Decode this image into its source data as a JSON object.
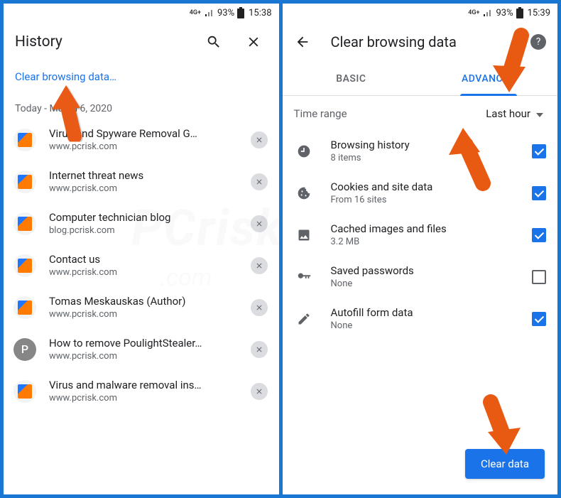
{
  "left": {
    "status": {
      "network": "4G+",
      "battery_pct": "93%",
      "time": "15:38"
    },
    "header": {
      "title": "History"
    },
    "clear_link": "Clear browsing data…",
    "date_header": "Today - March 6, 2020",
    "items": [
      {
        "title": "Virus and Spyware Removal G…",
        "url": "www.pcrisk.com",
        "icon": "pcrisk"
      },
      {
        "title": "Internet threat news",
        "url": "www.pcrisk.com",
        "icon": "pcrisk"
      },
      {
        "title": "Computer technician blog",
        "url": "blog.pcrisk.com",
        "icon": "pcrisk"
      },
      {
        "title": "Contact us",
        "url": "www.pcrisk.com",
        "icon": "pcrisk"
      },
      {
        "title": "Tomas Meskauskas (Author)",
        "url": "www.pcrisk.com",
        "icon": "pcrisk"
      },
      {
        "title": "How to remove PoulightStealer…",
        "url": "www.pcrisk.com",
        "icon": "p"
      },
      {
        "title": "Virus and malware removal ins…",
        "url": "www.pcrisk.com",
        "icon": "pcrisk"
      }
    ]
  },
  "right": {
    "status": {
      "network": "4G+",
      "battery_pct": "93%",
      "time": "15:39"
    },
    "header": {
      "title": "Clear browsing data"
    },
    "tabs": {
      "basic": "BASIC",
      "advanced": "ADVANCED",
      "active": "advanced"
    },
    "time_range": {
      "label": "Time range",
      "value": "Last hour"
    },
    "options": [
      {
        "title": "Browsing history",
        "sub": "8 items",
        "icon": "clock",
        "checked": true
      },
      {
        "title": "Cookies and site data",
        "sub": "From 16 sites",
        "icon": "cookie",
        "checked": true
      },
      {
        "title": "Cached images and files",
        "sub": "3.2 MB",
        "icon": "image",
        "checked": true
      },
      {
        "title": "Saved passwords",
        "sub": "None",
        "icon": "key",
        "checked": false
      },
      {
        "title": "Autofill form data",
        "sub": "None",
        "icon": "pen",
        "checked": true
      }
    ],
    "clear_button": "Clear data"
  },
  "watermark": {
    "main": "PCrisk",
    "sub": ".com"
  }
}
